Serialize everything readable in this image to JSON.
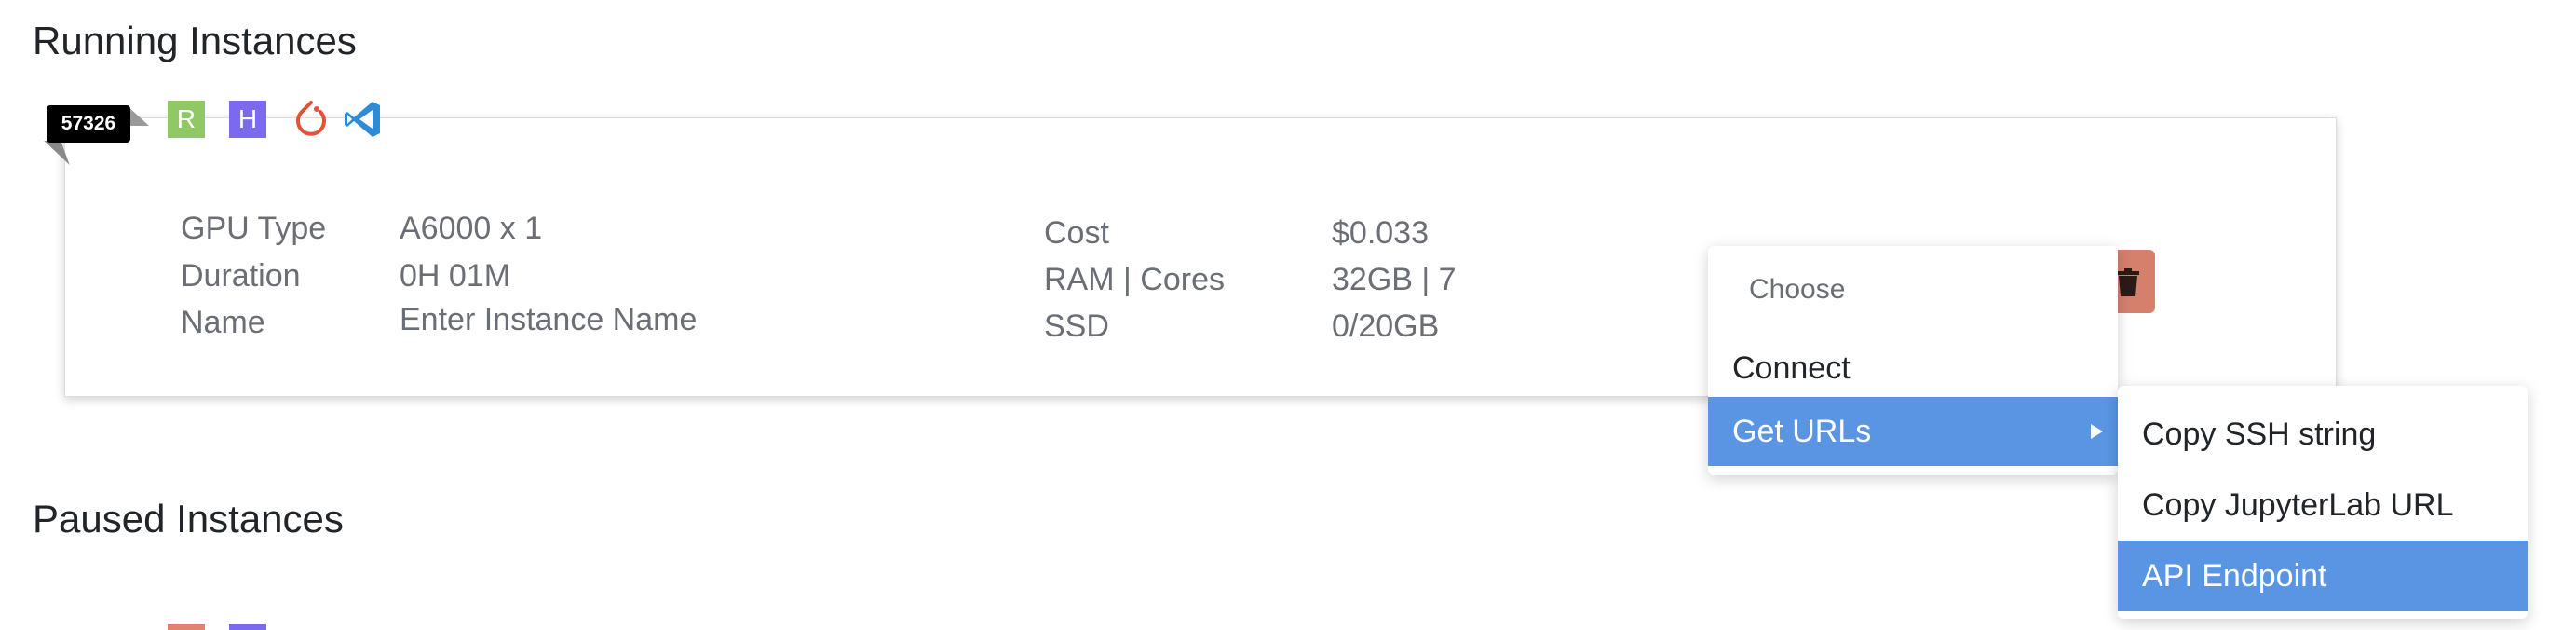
{
  "sections": {
    "running_title": "Running Instances",
    "paused_title": "Paused Instances"
  },
  "instance": {
    "port": "57326",
    "badges": {
      "r_label": "R",
      "h_label": "H"
    },
    "icons": [
      "r-badge-icon",
      "h-badge-icon",
      "pytorch-icon",
      "vscode-icon",
      "trash-icon"
    ],
    "left_fields": [
      {
        "label": "GPU Type",
        "value": "A6000 x 1"
      },
      {
        "label": "Duration",
        "value": "0H 01M"
      },
      {
        "label": "Name",
        "value": "Enter Instance Name"
      }
    ],
    "right_fields": [
      {
        "label": "Cost",
        "value": "$0.033"
      },
      {
        "label": "RAM | Cores",
        "value": "32GB | 7"
      },
      {
        "label": "SSD",
        "value": "0/20GB"
      }
    ]
  },
  "menu": {
    "header": "Choose",
    "items": [
      {
        "label": "Connect"
      },
      {
        "label": "Get URLs",
        "has_submenu": true,
        "active": true
      }
    ],
    "submenu": [
      {
        "label": "Copy SSH string"
      },
      {
        "label": "Copy JupyterLab URL"
      },
      {
        "label": "API Endpoint",
        "active": true
      }
    ]
  },
  "colors": {
    "accent": "#5a95e3",
    "delete": "#d4806d",
    "r_badge": "#8fc864",
    "h_badge": "#7b6af0"
  }
}
